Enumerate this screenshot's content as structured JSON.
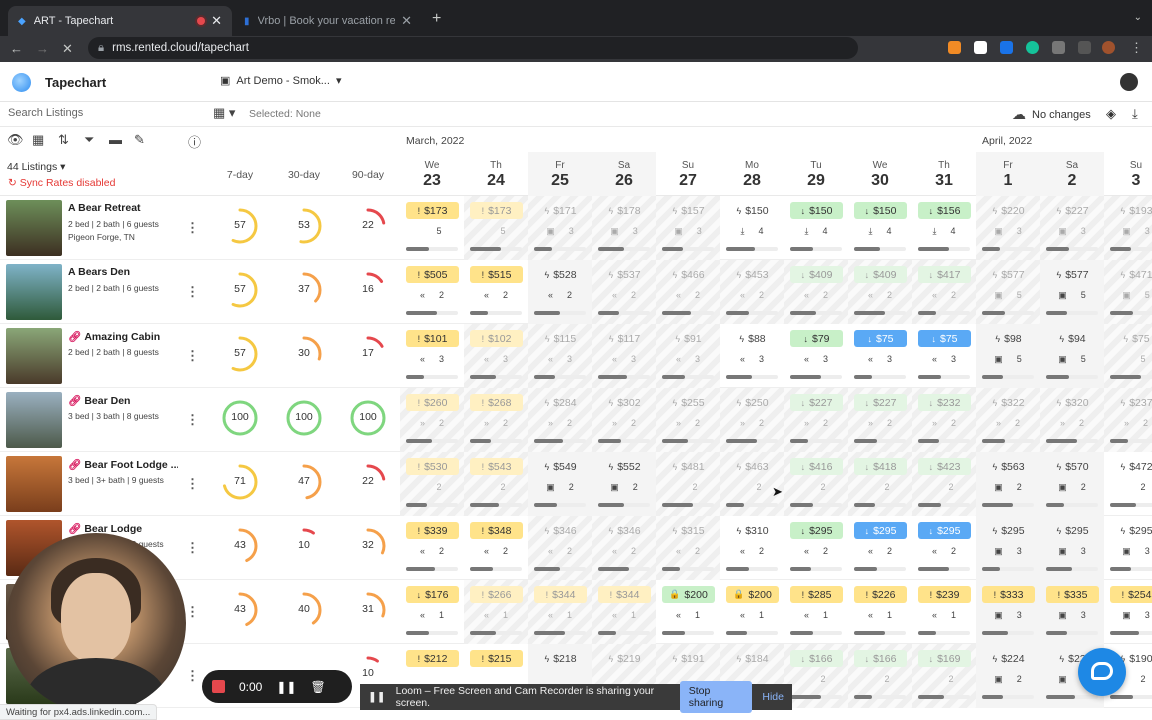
{
  "browser": {
    "tabs": [
      {
        "title": "ART - Tapechart"
      },
      {
        "title": "Vrbo | Book your vacation rentals"
      }
    ],
    "url": "rms.rented.cloud/tapechart",
    "status_text": "Waiting for px4.ads.linkedin.com..."
  },
  "app": {
    "title": "Tapechart",
    "property_selector": "Art Demo - Smok...",
    "search_placeholder": "Search Listings",
    "selected_text": "Selected: None",
    "sync_status": "No changes",
    "listing_count": "44 Listings",
    "sync_warning": "Sync Rates disabled",
    "occupancy_columns": [
      "7-day",
      "30-day",
      "90-day"
    ]
  },
  "calendar": {
    "months": [
      "March, 2022",
      "April, 2022"
    ],
    "days": [
      {
        "dow": "We",
        "date": "23"
      },
      {
        "dow": "Th",
        "date": "24"
      },
      {
        "dow": "Fr",
        "date": "25"
      },
      {
        "dow": "Sa",
        "date": "26"
      },
      {
        "dow": "Su",
        "date": "27"
      },
      {
        "dow": "Mo",
        "date": "28"
      },
      {
        "dow": "Tu",
        "date": "29"
      },
      {
        "dow": "We",
        "date": "30"
      },
      {
        "dow": "Th",
        "date": "31"
      },
      {
        "dow": "Fr",
        "date": "1"
      },
      {
        "dow": "Sa",
        "date": "2"
      },
      {
        "dow": "Su",
        "date": "3"
      }
    ]
  },
  "listings": [
    {
      "name": "A Bear Retreat",
      "desc": "2 bed | 2 bath | 6 guests",
      "loc": "Pigeon Forge, TN",
      "linked": false,
      "occ": [
        57,
        53,
        22
      ],
      "cells": [
        [
          "$173",
          "yellow",
          "!",
          "5",
          ""
        ],
        [
          "$173",
          "pyellow",
          "!",
          "5",
          ""
        ],
        [
          "$171",
          "faint",
          "ϟ",
          "3",
          "▣"
        ],
        [
          "$178",
          "faint",
          "ϟ",
          "3",
          "▣"
        ],
        [
          "$157",
          "faint",
          "ϟ",
          "3",
          "▣"
        ],
        [
          "$150",
          "plain",
          "ϟ",
          "4",
          "⤓"
        ],
        [
          "$150",
          "green",
          "↓",
          "4",
          "⤓"
        ],
        [
          "$150",
          "green",
          "↓",
          "4",
          "⤓"
        ],
        [
          "$156",
          "green",
          "↓",
          "4",
          "⤓"
        ],
        [
          "$220",
          "faint",
          "ϟ",
          "3",
          "▣"
        ],
        [
          "$227",
          "faint",
          "ϟ",
          "3",
          "▣"
        ],
        [
          "$193",
          "faint",
          "ϟ",
          "3",
          "▣"
        ]
      ]
    },
    {
      "name": "A Bears Den",
      "desc": "2 bed | 2 bath | 6 guests",
      "loc": "",
      "linked": false,
      "occ": [
        57,
        37,
        16
      ],
      "cells": [
        [
          "$505",
          "yellow",
          "!",
          "2",
          "«"
        ],
        [
          "$515",
          "yellow",
          "!",
          "2",
          "«"
        ],
        [
          "$528",
          "plain",
          "ϟ",
          "2",
          "«"
        ],
        [
          "$537",
          "faint",
          "ϟ",
          "2",
          "«"
        ],
        [
          "$466",
          "faint",
          "ϟ",
          "2",
          "«"
        ],
        [
          "$453",
          "faint",
          "ϟ",
          "2",
          "«"
        ],
        [
          "$409",
          "pgreen",
          "↓",
          "2",
          "«"
        ],
        [
          "$409",
          "pgreen",
          "↓",
          "2",
          "«"
        ],
        [
          "$417",
          "pgreen",
          "↓",
          "2",
          "«"
        ],
        [
          "$577",
          "faint",
          "ϟ",
          "5",
          "▣"
        ],
        [
          "$577",
          "plain",
          "ϟ",
          "5",
          "▣"
        ],
        [
          "$471",
          "faint",
          "ϟ",
          "5",
          "▣"
        ]
      ]
    },
    {
      "name": "Amazing Cabin",
      "desc": "2 bed | 2 bath | 8 guests",
      "loc": "",
      "linked": true,
      "occ": [
        57,
        30,
        17
      ],
      "cells": [
        [
          "$101",
          "yellow",
          "!",
          "3",
          "«"
        ],
        [
          "$102",
          "pyellow",
          "!",
          "3",
          "«"
        ],
        [
          "$115",
          "faint",
          "ϟ",
          "3",
          "«"
        ],
        [
          "$117",
          "faint",
          "ϟ",
          "3",
          "«"
        ],
        [
          "$91",
          "faint",
          "ϟ",
          "3",
          "«"
        ],
        [
          "$88",
          "plain",
          "ϟ",
          "3",
          "«"
        ],
        [
          "$79",
          "green",
          "↓",
          "3",
          "«"
        ],
        [
          "$75",
          "blue",
          "↓",
          "3",
          "«"
        ],
        [
          "$75",
          "blue",
          "↓",
          "3",
          "«"
        ],
        [
          "$98",
          "plain",
          "ϟ",
          "5",
          "▣"
        ],
        [
          "$94",
          "plain",
          "ϟ",
          "5",
          "▣"
        ],
        [
          "$75",
          "faint",
          "ϟ",
          "5",
          ""
        ]
      ]
    },
    {
      "name": "Bear Den",
      "desc": "3 bed | 3 bath | 8 guests",
      "loc": "",
      "linked": true,
      "occ": [
        100,
        100,
        100
      ],
      "cells": [
        [
          "$260",
          "pyellow",
          "!",
          "2",
          "»"
        ],
        [
          "$268",
          "pyellow",
          "!",
          "2",
          "»"
        ],
        [
          "$284",
          "faint",
          "ϟ",
          "2",
          "»"
        ],
        [
          "$302",
          "faint",
          "ϟ",
          "2",
          "»"
        ],
        [
          "$255",
          "faint",
          "ϟ",
          "2",
          "»"
        ],
        [
          "$250",
          "faint",
          "ϟ",
          "2",
          "»"
        ],
        [
          "$227",
          "pgreen",
          "↓",
          "2",
          "»"
        ],
        [
          "$227",
          "pgreen",
          "↓",
          "2",
          "»"
        ],
        [
          "$232",
          "pgreen",
          "↓",
          "2",
          "»"
        ],
        [
          "$322",
          "faint",
          "ϟ",
          "2",
          "»"
        ],
        [
          "$320",
          "faint",
          "ϟ",
          "2",
          "»"
        ],
        [
          "$237",
          "faint",
          "ϟ",
          "2",
          "»"
        ]
      ]
    },
    {
      "name": "Bear Foot Lodge ...",
      "desc": "3 bed | 3+ bath | 9 guests",
      "loc": "",
      "linked": true,
      "occ": [
        71,
        47,
        22
      ],
      "cells": [
        [
          "$530",
          "pyellow",
          "!",
          "2",
          ""
        ],
        [
          "$543",
          "pyellow",
          "!",
          "2",
          ""
        ],
        [
          "$549",
          "plain",
          "ϟ",
          "2",
          "▣"
        ],
        [
          "$552",
          "plain",
          "ϟ",
          "2",
          "▣"
        ],
        [
          "$481",
          "faint",
          "ϟ",
          "2",
          ""
        ],
        [
          "$463",
          "faint",
          "ϟ",
          "2",
          ""
        ],
        [
          "$416",
          "pgreen",
          "↓",
          "2",
          ""
        ],
        [
          "$418",
          "pgreen",
          "↓",
          "2",
          ""
        ],
        [
          "$423",
          "pgreen",
          "↓",
          "2",
          ""
        ],
        [
          "$563",
          "plain",
          "ϟ",
          "2",
          "▣"
        ],
        [
          "$570",
          "plain",
          "ϟ",
          "2",
          "▣"
        ],
        [
          "$472",
          "plain",
          "ϟ",
          "2",
          ""
        ]
      ]
    },
    {
      "name": "Bear Lodge",
      "desc": "3 bed | 2 bath | 12 guests",
      "loc": "",
      "linked": true,
      "occ": [
        43,
        10,
        32
      ],
      "cells": [
        [
          "$339",
          "yellow",
          "!",
          "2",
          "«"
        ],
        [
          "$348",
          "yellow",
          "!",
          "2",
          "«"
        ],
        [
          "$346",
          "faint",
          "ϟ",
          "2",
          "«"
        ],
        [
          "$346",
          "faint",
          "ϟ",
          "2",
          "«"
        ],
        [
          "$315",
          "faint",
          "ϟ",
          "2",
          "«"
        ],
        [
          "$310",
          "plain",
          "ϟ",
          "2",
          "«"
        ],
        [
          "$295",
          "green",
          "↓",
          "2",
          "«"
        ],
        [
          "$295",
          "blue",
          "↓",
          "2",
          "«"
        ],
        [
          "$295",
          "blue",
          "↓",
          "2",
          "«"
        ],
        [
          "$295",
          "plain",
          "ϟ",
          "3",
          "▣"
        ],
        [
          "$295",
          "plain",
          "ϟ",
          "3",
          "▣"
        ],
        [
          "$295",
          "plain",
          "ϟ",
          "3",
          "▣"
        ]
      ]
    },
    {
      "name": "",
      "desc": "",
      "loc": "",
      "linked": false,
      "occ": [
        43,
        40,
        31
      ],
      "cells": [
        [
          "$176",
          "yellow",
          "↓",
          "1",
          "«"
        ],
        [
          "$266",
          "pyellow",
          "!",
          "1",
          "«"
        ],
        [
          "$344",
          "pyellow",
          "!",
          "1",
          "«"
        ],
        [
          "$344",
          "pyellow",
          "!",
          "1",
          "«"
        ],
        [
          "$200",
          "green",
          "🔒",
          "1",
          "«"
        ],
        [
          "$200",
          "yellow",
          "🔒",
          "1",
          "«"
        ],
        [
          "$285",
          "yellow",
          "!",
          "1",
          "«"
        ],
        [
          "$226",
          "yellow",
          "!",
          "1",
          "«"
        ],
        [
          "$239",
          "yellow",
          "!",
          "1",
          "«"
        ],
        [
          "$333",
          "yellow",
          "!",
          "3",
          "▣"
        ],
        [
          "$335",
          "yellow",
          "!",
          "3",
          "▣"
        ],
        [
          "$254",
          "yellow",
          "!",
          "3",
          "▣"
        ]
      ]
    },
    {
      "name": "",
      "desc": "",
      "loc": "",
      "linked": false,
      "occ": [
        null,
        null,
        10
      ],
      "cells": [
        [
          "$212",
          "yellow",
          "!",
          "",
          ""
        ],
        [
          "$215",
          "yellow",
          "!",
          "",
          ""
        ],
        [
          "$218",
          "plain",
          "ϟ",
          "",
          ""
        ],
        [
          "$219",
          "faint",
          "ϟ",
          "",
          ""
        ],
        [
          "$191",
          "faint",
          "ϟ",
          "",
          ""
        ],
        [
          "$184",
          "faint",
          "ϟ",
          "",
          ""
        ],
        [
          "$166",
          "pgreen",
          "↓",
          "2",
          ""
        ],
        [
          "$166",
          "pgreen",
          "↓",
          "2",
          ""
        ],
        [
          "$169",
          "pgreen",
          "↓",
          "2",
          ""
        ],
        [
          "$224",
          "plain",
          "ϟ",
          "2",
          "▣"
        ],
        [
          "$22",
          "plain",
          "ϟ",
          "2",
          "▣"
        ],
        [
          "$190",
          "plain",
          "ϟ",
          "2",
          ""
        ]
      ]
    }
  ],
  "loom": {
    "timer": "0:00",
    "banner_text": "Loom – Free Screen and Cam Recorder is sharing your screen.",
    "stop_label": "Stop sharing",
    "hide_label": "Hide"
  }
}
